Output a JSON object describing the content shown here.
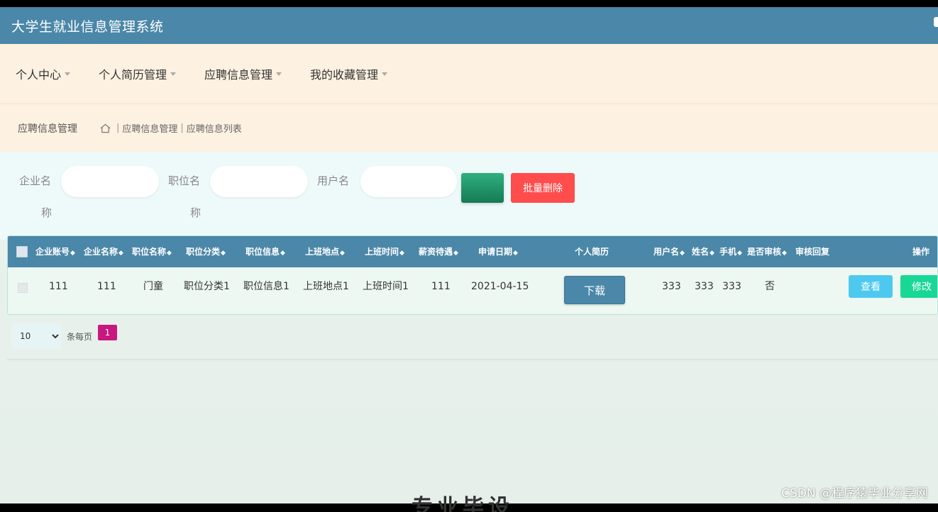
{
  "app": {
    "title": "大学生就业信息管理系统"
  },
  "nav": {
    "items": [
      {
        "label": "个人中心"
      },
      {
        "label": "个人简历管理"
      },
      {
        "label": "应聘信息管理"
      },
      {
        "label": "我的收藏管理"
      }
    ]
  },
  "breadcrumb": {
    "title": "应聘信息管理",
    "items": [
      "应聘信息管理",
      "应聘信息列表"
    ]
  },
  "search": {
    "company_label_1": "企业名",
    "company_label_2": "称",
    "job_label_1": "职位名",
    "job_label_2": "称",
    "user_label": "用户名",
    "search_button": "",
    "batch_delete": "批量删除"
  },
  "table": {
    "headers": [
      "企业账号",
      "企业名称",
      "职位名称",
      "职位分类",
      "职位信息",
      "上班地点",
      "上班时间",
      "薪资待遇",
      "申请日期",
      "个人简历",
      "用户名",
      "姓名",
      "手机",
      "是否审核",
      "审核回复",
      "操作"
    ],
    "rows": [
      {
        "company_account": "111",
        "company_name": "111",
        "job_name": "门童",
        "job_category": "职位分类1",
        "job_info": "职位信息1",
        "location": "上班地点1",
        "work_time": "上班时间1",
        "salary": "111",
        "apply_date": "2021-04-15",
        "resume_button": "下载",
        "username": "333",
        "name": "333",
        "phone": "333",
        "reviewed": "否",
        "review_reply": "",
        "view_button": "查看",
        "edit_button": "修改"
      }
    ]
  },
  "pager": {
    "page_size": "10",
    "per_page_label": "条每页",
    "current_page": "1"
  },
  "watermark": "CSDN @程序猿毕业分享网",
  "footer_text": "专业毕设"
}
